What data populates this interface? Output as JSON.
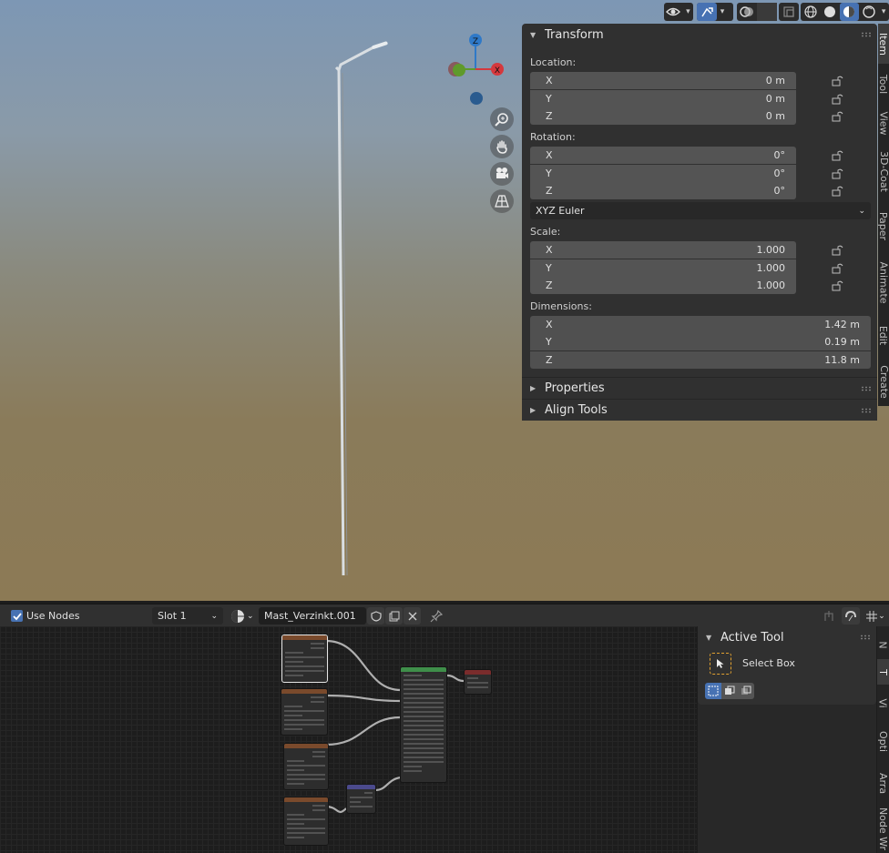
{
  "viewport": {
    "gizmo": {
      "z_label": "Z",
      "x_label": "X"
    }
  },
  "npanel": {
    "transform_title": "Transform",
    "location_label": "Location:",
    "location": [
      {
        "axis": "X",
        "value": "0 m"
      },
      {
        "axis": "Y",
        "value": "0 m"
      },
      {
        "axis": "Z",
        "value": "0 m"
      }
    ],
    "rotation_label": "Rotation:",
    "rotation": [
      {
        "axis": "X",
        "value": "0°"
      },
      {
        "axis": "Y",
        "value": "0°"
      },
      {
        "axis": "Z",
        "value": "0°"
      }
    ],
    "rotation_mode": "XYZ Euler",
    "scale_label": "Scale:",
    "scale": [
      {
        "axis": "X",
        "value": "1.000"
      },
      {
        "axis": "Y",
        "value": "1.000"
      },
      {
        "axis": "Z",
        "value": "1.000"
      }
    ],
    "dimensions_label": "Dimensions:",
    "dimensions": [
      {
        "axis": "X",
        "value": "1.42 m"
      },
      {
        "axis": "Y",
        "value": "0.19 m"
      },
      {
        "axis": "Z",
        "value": "11.8 m"
      }
    ],
    "properties_title": "Properties",
    "align_tools_title": "Align Tools"
  },
  "sidebar_tabs": [
    "Item",
    "Tool",
    "View",
    "3D-Coat",
    "Paper",
    "Animate",
    "Edit",
    "Create"
  ],
  "node_editor": {
    "use_nodes_label": "Use Nodes",
    "use_nodes_checked": true,
    "slot": "Slot 1",
    "material_name": "Mast_Verzinkt.001",
    "active_tool_title": "Active Tool",
    "active_tool_name": "Select Box",
    "sidebar_tabs": [
      "N",
      "T",
      "Vi",
      "Opti",
      "Arra",
      "Node Wr"
    ]
  },
  "colors": {
    "accent": "#4772b3",
    "gizmo_x": "#d5383d",
    "gizmo_y": "#5f9a2b",
    "gizmo_z": "#2f79c8"
  }
}
